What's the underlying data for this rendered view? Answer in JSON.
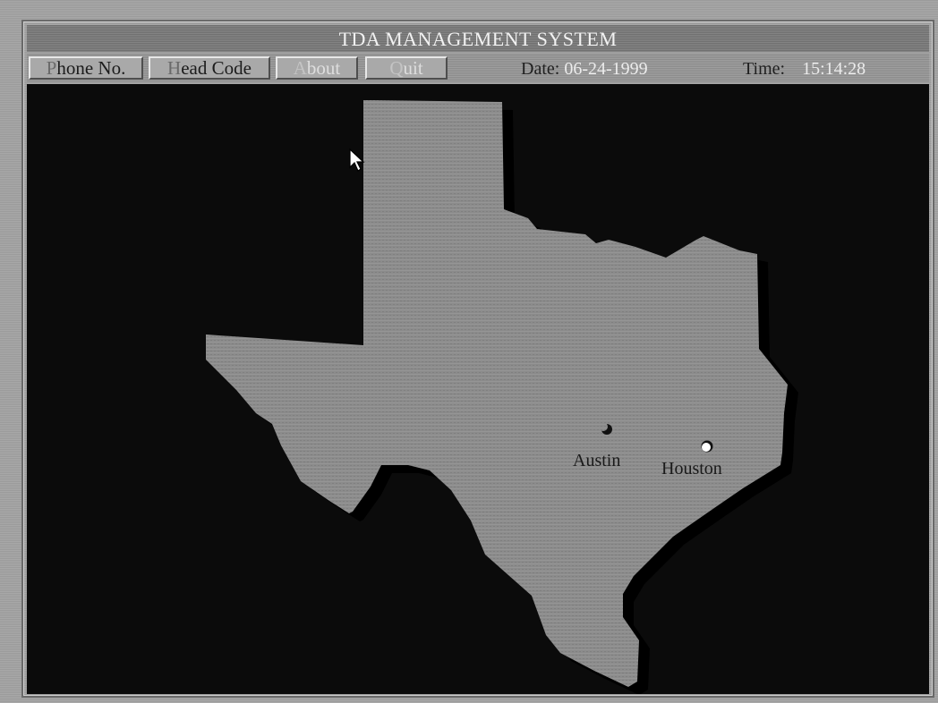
{
  "window": {
    "title": "TDA MANAGEMENT SYSTEM"
  },
  "menu": {
    "phone": {
      "hotkey": "P",
      "rest": "hone No."
    },
    "head_code": {
      "hotkey": "H",
      "rest": "ead Code"
    },
    "about": {
      "hotkey": "A",
      "rest": "bout"
    },
    "quit": {
      "hotkey": "Q",
      "rest": "uit"
    }
  },
  "status": {
    "date_label": "Date:",
    "date_value": "06-24-1999",
    "time_label": "Time:",
    "time_value": "15:14:28"
  },
  "map": {
    "region": "Texas",
    "cities": [
      {
        "name": "Austin",
        "marker": "crescent"
      },
      {
        "name": "Houston",
        "marker": "white-dot"
      }
    ]
  },
  "colors": {
    "map_background": "#0b0b0b",
    "land": "#8a8a8a",
    "title_text": "#f2f2f2"
  }
}
